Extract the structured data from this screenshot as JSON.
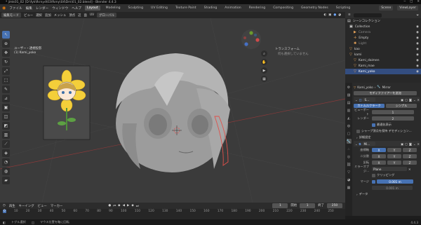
{
  "window": {
    "title": "* jimk01_02 [D:\\fyk\\fkrnyd\\03\\fkmy\\04\\Dm\\01_02.blend] - Blender 4.4.3"
  },
  "menubar": {
    "menus": [
      "ファイル",
      "編集",
      "レンダー",
      "ウィンドウ",
      "ヘルプ"
    ],
    "workspaces": [
      "Layout",
      "Modeling",
      "Sculpting",
      "UV Editing",
      "Texture Paint",
      "Shading",
      "Animation",
      "Rendering",
      "Compositing",
      "Geometry Nodes",
      "Scripting"
    ],
    "active_workspace": "Layout",
    "scene": "Scene",
    "view_layer": "ViewLayer"
  },
  "viewport_header": {
    "mode": "編集モード",
    "items": [
      "ビュー",
      "選択",
      "追加",
      "メッシュ",
      "頂点",
      "辺",
      "面",
      "UV"
    ],
    "transform": "グローバル"
  },
  "viewport": {
    "info_line1": "ユーザー・透視投影",
    "info_line2": "(1) Kami_yoko",
    "transform_panel_title": "トランスフォーム",
    "transform_panel_msg": "何も選択していません"
  },
  "outliner": {
    "title": "シーンコレクション",
    "items": [
      {
        "name": "Collection",
        "icon": "collection-icon"
      },
      {
        "name": "Camera",
        "icon": "camera-icon"
      },
      {
        "name": "Empty",
        "icon": "empty-icon"
      },
      {
        "name": "Light",
        "icon": "light-icon"
      },
      {
        "name": "kao",
        "icon": "mesh-icon"
      },
      {
        "name": "kami",
        "icon": "mesh-icon"
      },
      {
        "name": "Kami_daimen",
        "icon": "mesh-icon"
      },
      {
        "name": "Kami_mae",
        "icon": "mesh-icon"
      },
      {
        "name": "Kami_yoko",
        "icon": "mesh-icon"
      }
    ],
    "selected": "Kami_yoko"
  },
  "properties": {
    "object": "Kami_yoko",
    "modifier_tab": "Mirror",
    "add_modifier": "モディファイアーを追加",
    "subdiv": {
      "name": "S...",
      "type_catmull": "カトムルクラーク",
      "type_simple": "シンプル",
      "viewport_label": "ビューポート",
      "viewport_value": "1",
      "render_label": "レンダー",
      "render_value": "2",
      "optimal_label": "最適化表示",
      "sharp_label": "シャープ頂点を保持 デセディション..."
    },
    "detail_label": "詳細設定",
    "mirror": {
      "name": "Mi...",
      "axis_label": "座標軸",
      "bisect_label": "二分割",
      "flip_label": "反転",
      "axes": [
        "X",
        "Y",
        "Z"
      ],
      "mirror_object_label": "ミラーオブジ...",
      "mirror_object": "Plane",
      "clipping": "クリッピング",
      "merge_label": "マージ",
      "merge_value": "0.001 m",
      "merge_value2": "0.001 m",
      "data_label": "データ"
    }
  },
  "timeline": {
    "menus": [
      "再生",
      "キーイング",
      "ビュー",
      "マーカー"
    ],
    "current_frame": "1",
    "start_label": "開始",
    "start": "1",
    "end_label": "終了",
    "end": "250",
    "ticks": [
      "0",
      "10",
      "20",
      "30",
      "40",
      "50",
      "60",
      "70",
      "80",
      "90",
      "100",
      "110",
      "120",
      "130",
      "140",
      "150",
      "160",
      "170",
      "180",
      "190",
      "200",
      "210",
      "220",
      "230",
      "240",
      "250"
    ]
  },
  "statusbar": {
    "select": "トグル選択",
    "rotate": "マウス位置を軸に回転",
    "version": "4.4.3"
  },
  "colors": {
    "accent": "#4772b3",
    "selection": "#334d80",
    "viewport_bg": "#3b3b3b"
  }
}
